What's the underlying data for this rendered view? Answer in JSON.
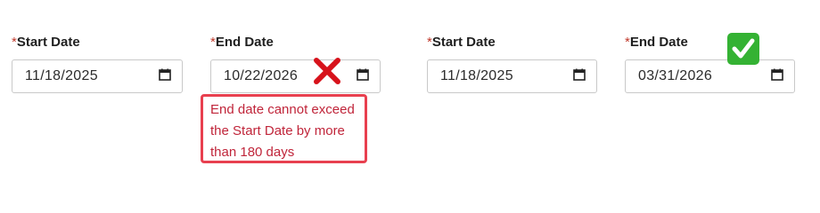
{
  "left_pair": {
    "start": {
      "required_mark": "*",
      "label": "Start Date",
      "value": "11/18/2025"
    },
    "end": {
      "required_mark": "*",
      "label": "End Date",
      "value": "10/22/2026"
    },
    "validation_icon": "red-x-icon",
    "error_message": "End date cannot exceed the Start Date by more than 180 days"
  },
  "right_pair": {
    "start": {
      "required_mark": "*",
      "label": "Start Date",
      "value": "11/18/2025"
    },
    "end": {
      "required_mark": "*",
      "label": "End Date",
      "value": "03/31/2026"
    },
    "validation_icon": "green-check-icon"
  },
  "icons": {
    "calendar": "calendar-icon"
  },
  "colors": {
    "required": "#c0392b",
    "error_border": "#e8404f",
    "error_text": "#c0253a",
    "invalid_mark": "#d7121b",
    "valid_badge": "#34b233"
  }
}
